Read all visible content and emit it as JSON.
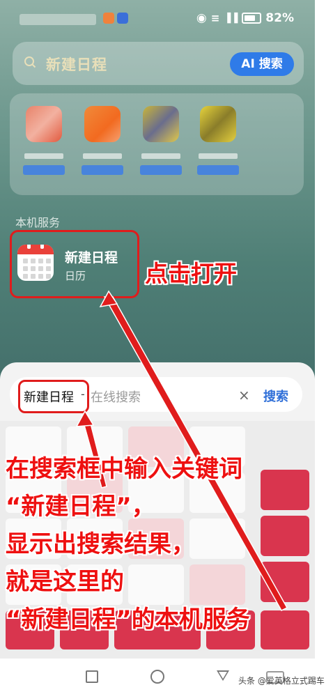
{
  "status": {
    "battery": "82%"
  },
  "search": {
    "query": "新建日程",
    "ai_button": "AI 搜索"
  },
  "section": {
    "title": "本机服务"
  },
  "result": {
    "title": "新建日程",
    "subtitle": "日历"
  },
  "callout": {
    "open": "点击打开"
  },
  "input": {
    "value": "新建日程",
    "separator": "-",
    "placeholder": "在线搜索",
    "clear": "×",
    "search_button": "搜索"
  },
  "annotation": {
    "line1": "在搜索框中输入关键词",
    "line2": "“新建日程”，",
    "line3": "显示出搜索结果，",
    "line4": "就是这里的",
    "line5": "“新建日程”的本机服务"
  },
  "watermark": "头条 @爱英格立式踢车",
  "colors": {
    "accent": "#2f7be8",
    "annotation": "#ee1010",
    "calendar_red": "#e9413a"
  }
}
